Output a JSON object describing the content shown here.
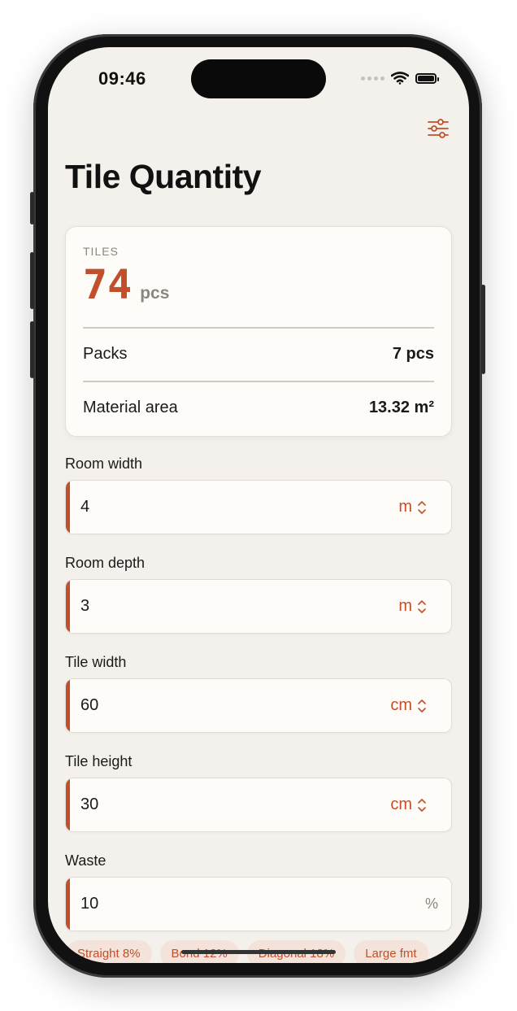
{
  "status_bar": {
    "time": "09:46"
  },
  "page": {
    "title": "Tile Quantity"
  },
  "summary": {
    "label": "TILES",
    "value": "74",
    "unit": "pcs",
    "rows": [
      {
        "label": "Packs",
        "value": "7 pcs"
      },
      {
        "label": "Material area",
        "value": "13.32 m²"
      }
    ]
  },
  "fields": [
    {
      "label": "Room width",
      "value": "4",
      "unit": "m"
    },
    {
      "label": "Room depth",
      "value": "3",
      "unit": "m"
    },
    {
      "label": "Tile width",
      "value": "60",
      "unit": "cm"
    },
    {
      "label": "Tile height",
      "value": "30",
      "unit": "cm"
    },
    {
      "label": "Waste",
      "value": "10",
      "unit": "%"
    }
  ],
  "waste_presets": [
    "Straight 8%",
    "Bond 12%",
    "Diagonal 18%",
    "Large fmt"
  ],
  "icons": {
    "settings": "sliders-icon",
    "unit_picker": "chevron-up-down-icon",
    "wifi": "wifi-icon",
    "battery": "battery-icon",
    "signal": "signal-dots-icon"
  },
  "colors": {
    "accent": "#c24f2b",
    "background": "#f4f1ec",
    "card": "#fdfcf9",
    "secondary_text": "#8b8680"
  }
}
